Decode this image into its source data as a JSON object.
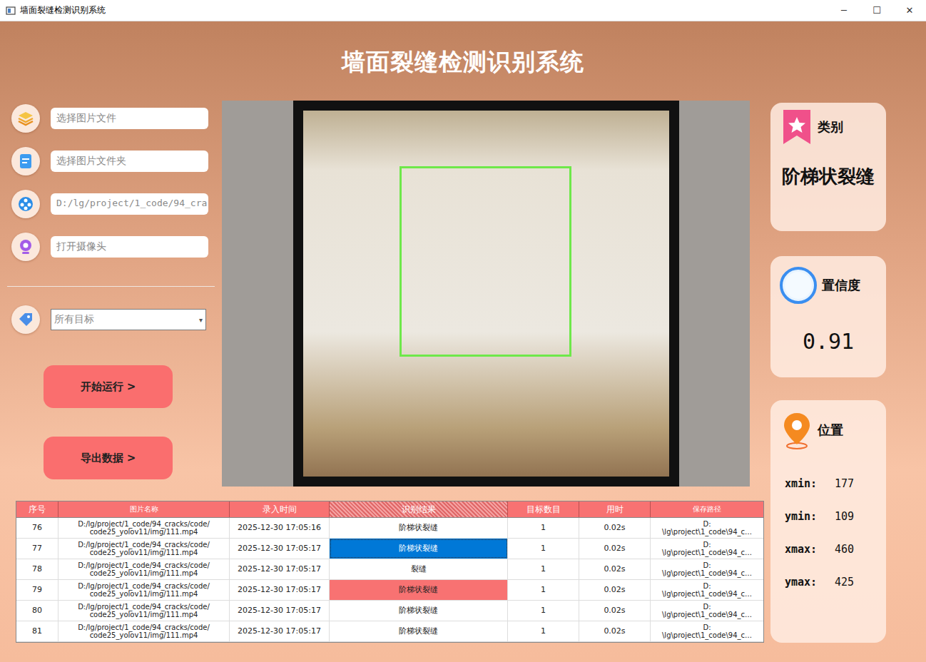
{
  "window": {
    "title": "墙面裂缝检测识别系统",
    "controls": [
      "─",
      "☐",
      "✕"
    ]
  },
  "header": {
    "title": "墙面裂缝检测识别系统"
  },
  "inputs": [
    {
      "text": "选择图片文件",
      "kind": "placeholder",
      "icon": "image"
    },
    {
      "text": "选择图片文件夹",
      "kind": "placeholder",
      "icon": "folder"
    },
    {
      "text": "D:/lg/project/1_code/94_cra",
      "kind": "value",
      "icon": "video"
    },
    {
      "text": "打开摄像头",
      "kind": "placeholder",
      "icon": "camera"
    }
  ],
  "filter": {
    "value": "所有目标",
    "arrow": "▾"
  },
  "buttons": [
    {
      "label": "开始运行 >"
    },
    {
      "label": "导出数据 >"
    }
  ],
  "category": {
    "title": "类别",
    "value": "阶梯状裂缝"
  },
  "confidence": {
    "title": "置信度",
    "value": "0.91"
  },
  "position": {
    "title": "位置",
    "coords": [
      {
        "label": "xmin:",
        "value": "177"
      },
      {
        "label": "ymin:",
        "value": "109"
      },
      {
        "label": "xmax:",
        "value": "460"
      },
      {
        "label": "ymax:",
        "value": "425"
      }
    ]
  },
  "table": {
    "columns": [
      {
        "label": "序号",
        "selected": false
      },
      {
        "label": "图片名称",
        "selected": false
      },
      {
        "label": "录入时间",
        "selected": false
      },
      {
        "label": "识别结果",
        "selected": true
      },
      {
        "label": "目标数目",
        "selected": false
      },
      {
        "label": "用时",
        "selected": false
      },
      {
        "label": "保存路径",
        "selected": false
      }
    ],
    "rows": [
      {
        "cells": [
          "76",
          "D:/lg/project/1_code/94_cracks/code/\ncode25_yolov11/img/111.mp4",
          "2025-12-30 17:05:16",
          "阶梯状裂缝",
          "1",
          "0.02s",
          "D:\n\\lg\\project\\1_code\\94_c…"
        ],
        "result_state": "none"
      },
      {
        "cells": [
          "77",
          "D:/lg/project/1_code/94_cracks/code/\ncode25_yolov11/img/111.mp4",
          "2025-12-30 17:05:17",
          "阶梯状裂缝",
          "1",
          "0.02s",
          "D:\n\\lg\\project\\1_code\\94_c…"
        ],
        "result_state": "selected"
      },
      {
        "cells": [
          "78",
          "D:/lg/project/1_code/94_cracks/code/\ncode25_yolov11/img/111.mp4",
          "2025-12-30 17:05:17",
          "裂缝",
          "1",
          "0.02s",
          "D:\n\\lg\\project\\1_code\\94_c…"
        ],
        "result_state": "none"
      },
      {
        "cells": [
          "79",
          "D:/lg/project/1_code/94_cracks/code/\ncode25_yolov11/img/111.mp4",
          "2025-12-30 17:05:17",
          "阶梯状裂缝",
          "1",
          "0.02s",
          "D:\n\\lg\\project\\1_code\\94_c…"
        ],
        "result_state": "highlighted"
      },
      {
        "cells": [
          "80",
          "D:/lg/project/1_code/94_cracks/code/\ncode25_yolov11/img/111.mp4",
          "2025-12-30 17:05:17",
          "阶梯状裂缝",
          "1",
          "0.02s",
          "D:\n\\lg\\project\\1_code\\94_c…"
        ],
        "result_state": "none"
      },
      {
        "cells": [
          "81",
          "D:/lg/project/1_code/94_cracks/code/\ncode25_yolov11/img/111.mp4",
          "2025-12-30 17:05:17",
          "阶梯状裂缝",
          "1",
          "0.02s",
          "D:\n\\lg\\project\\1_code\\94_c…"
        ],
        "result_state": "none"
      }
    ]
  }
}
